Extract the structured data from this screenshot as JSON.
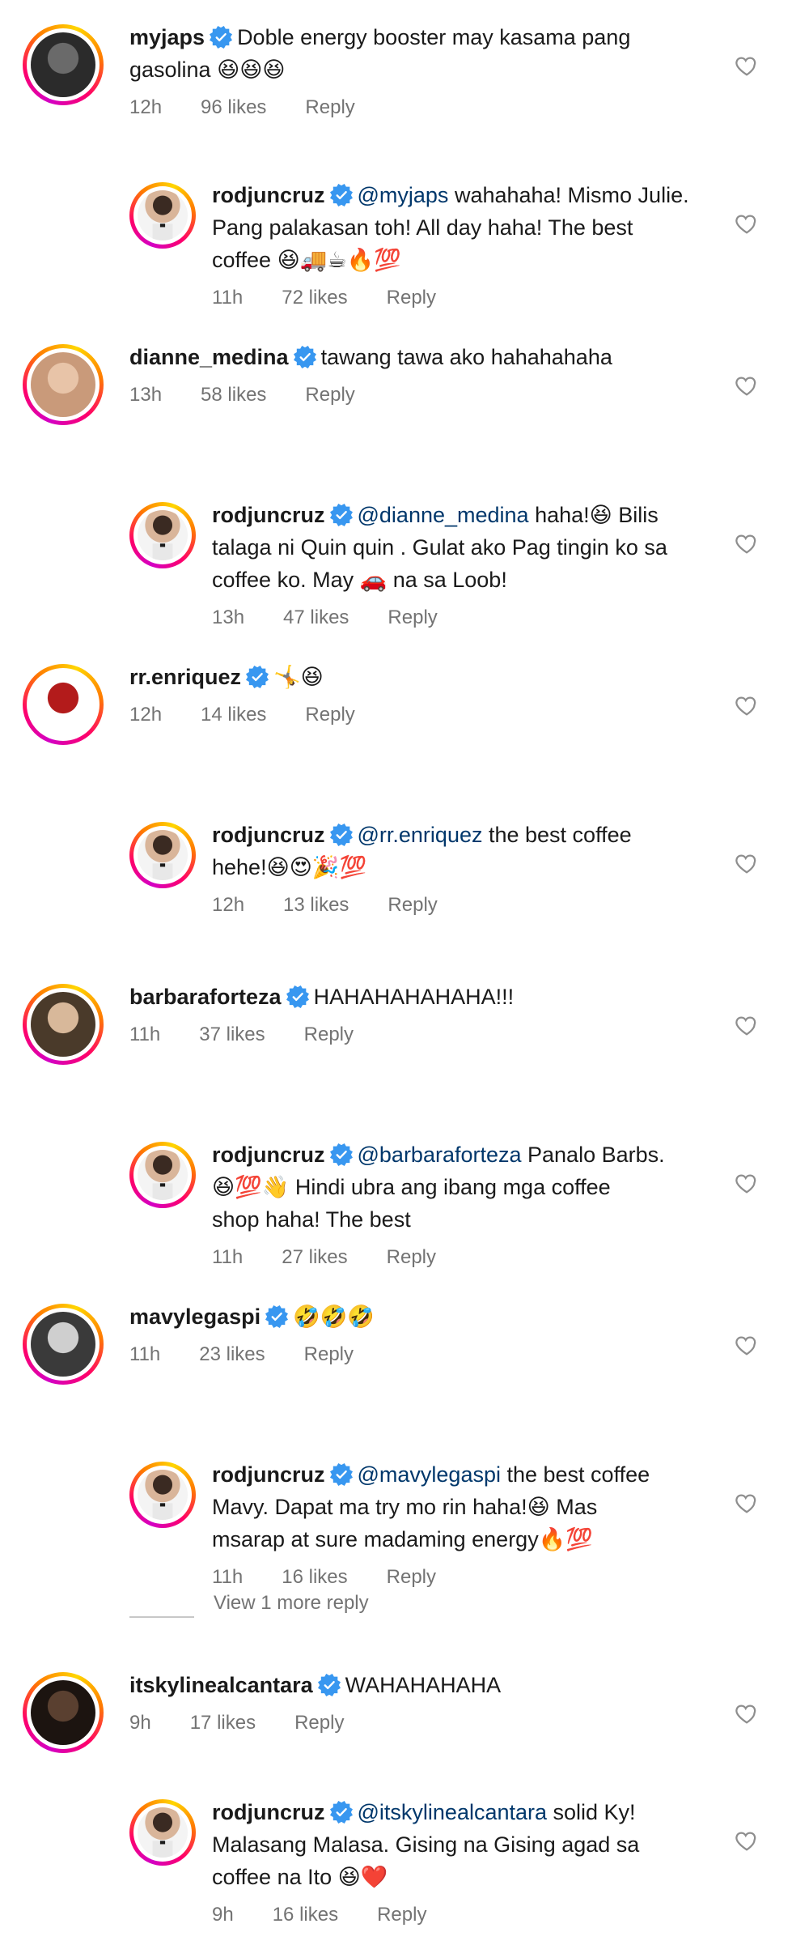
{
  "comments": [
    {
      "user": "myjaps",
      "lines": [
        "Doble energy booster may kasama pang",
        "gasolina 😆😆😆"
      ],
      "time": "12h",
      "likes": "96 likes",
      "reply": "Reply",
      "reply_to": {
        "user": "rodjuncruz",
        "mention": "@myjaps",
        "lines": [
          " wahahaha! Mismo Julie.",
          "Pang palakasan toh! All day haha! The best",
          "coffee 😆🚚☕🔥💯"
        ],
        "time": "11h",
        "likes": "72 likes",
        "reply": "Reply"
      }
    },
    {
      "user": "dianne_medina",
      "lines": [
        "tawang tawa ako hahahahaha"
      ],
      "time": "13h",
      "likes": "58 likes",
      "reply": "Reply",
      "reply_to": {
        "user": "rodjuncruz",
        "mention": "@dianne_medina",
        "lines": [
          " haha!😆 Bilis",
          "talaga ni Quin quin . Gulat ako Pag tingin ko sa",
          "coffee ko. May 🚗  na sa Loob!"
        ],
        "time": "13h",
        "likes": "47 likes",
        "reply": "Reply"
      }
    },
    {
      "user": "rr.enriquez",
      "lines": [
        "🤸😆"
      ],
      "time": "12h",
      "likes": "14 likes",
      "reply": "Reply",
      "reply_to": {
        "user": "rodjuncruz",
        "mention": "@rr.enriquez",
        "lines": [
          " the best coffee",
          "hehe!😆😍🎉💯"
        ],
        "time": "12h",
        "likes": "13 likes",
        "reply": "Reply"
      }
    },
    {
      "user": "barbaraforteza",
      "lines": [
        "HAHAHAHAHAHA!!!"
      ],
      "time": "11h",
      "likes": "37 likes",
      "reply": "Reply",
      "reply_to": {
        "user": "rodjuncruz",
        "mention": "@barbaraforteza",
        "lines": [
          " Panalo Barbs.",
          "😆💯👋 Hindi ubra ang ibang mga coffee",
          "shop haha! The best"
        ],
        "time": "11h",
        "likes": "27 likes",
        "reply": "Reply"
      }
    },
    {
      "user": "mavylegaspi",
      "lines": [
        "🤣🤣🤣"
      ],
      "time": "11h",
      "likes": "23 likes",
      "reply": "Reply",
      "reply_to": {
        "user": "rodjuncruz",
        "mention": "@mavylegaspi",
        "lines": [
          " the best coffee",
          "Mavy. Dapat ma try mo rin haha!😆 Mas",
          "msarap at sure madaming energy🔥💯"
        ],
        "time": "11h",
        "likes": "16 likes",
        "reply": "Reply"
      }
    },
    {
      "user": "itskylinealcantara",
      "lines": [
        "WAHAHAHAHA"
      ],
      "time": "9h",
      "likes": "17 likes",
      "reply": "Reply",
      "reply_to": {
        "user": "rodjuncruz",
        "mention": "@itskylinealcantara",
        "lines": [
          " solid Ky!",
          "Malasang Malasa. Gising na Gising agad sa",
          "coffee na Ito 😆❤️"
        ],
        "time": "9h",
        "likes": "16 likes",
        "reply": "Reply"
      }
    }
  ],
  "view_more": "View 1 more reply",
  "colors": {
    "mention": "#00376b",
    "verified": "#3897f0",
    "meta": "#737373"
  },
  "icons": {
    "like": "heart-outline-icon",
    "verified": "verified-badge-icon"
  }
}
